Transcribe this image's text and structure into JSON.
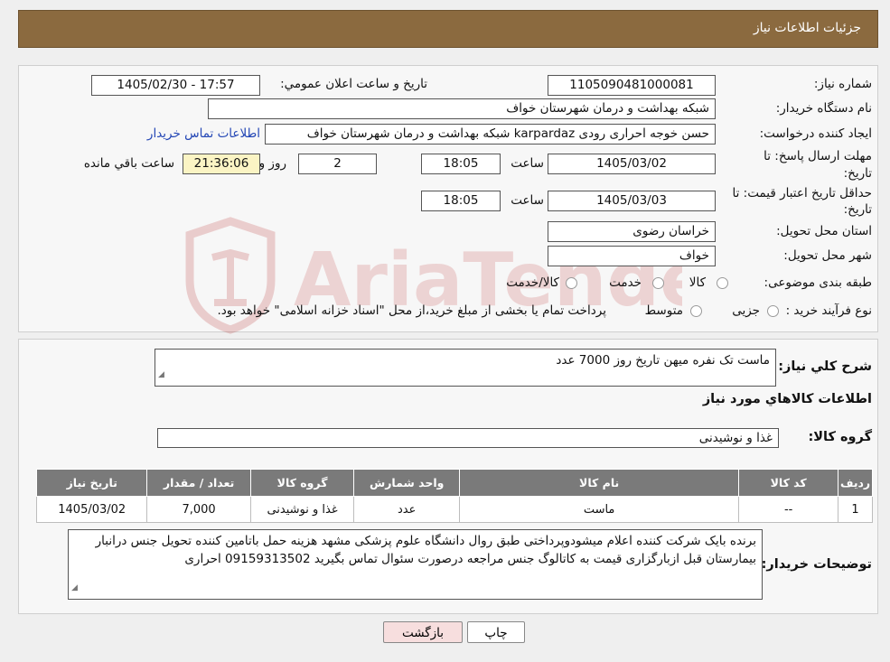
{
  "header": {
    "title": "جزئیات اطلاعات نیاز"
  },
  "form": {
    "need_number_label": "شماره نیاز:",
    "need_number": "1105090481000081",
    "announce_label": "تاريخ و ساعت اعلان عمومي:",
    "announce_value": "1405/02/30 - 17:57",
    "buyer_org_label": "نام دستگاه خریدار:",
    "buyer_org": "شبکه بهداشت و درمان شهرستان خواف",
    "creator_label": "ایجاد کننده درخواست:",
    "creator": "حسن خوجه احراری رودی karpardaz شبکه بهداشت و درمان شهرستان خواف",
    "contact_link": "اطلاعات تماس خریدار",
    "deadline_label_1": "مهلت ارسال پاسخ: تا",
    "deadline_label_2": "تاریخ:",
    "deadline_date": "1405/03/02",
    "time_label": "ساعت",
    "deadline_time": "18:05",
    "days_remaining": "2",
    "day_and_label": "روز و",
    "remaining_time": "21:36:06",
    "remaining_label": "ساعت باقي مانده",
    "price_valid_label_1": "حداقل تاریخ اعتبار قیمت: تا",
    "price_valid_label_2": "تاریخ:",
    "price_valid_date": "1405/03/03",
    "price_valid_time": "18:05",
    "province_label": "استان محل تحویل:",
    "province": "خراسان رضوی",
    "city_label": "شهر محل تحویل:",
    "city": "خواف",
    "category_label": "طبقه بندی موضوعی:",
    "category_options": [
      "کالا",
      "خدمت",
      "کالا/خدمت"
    ],
    "process_label": "نوع فرآیند خرید :",
    "process_options": [
      "جزیی",
      "متوسط"
    ],
    "process_note": "پرداخت تمام یا بخشی از مبلغ خرید،از محل \"اسناد خزانه اسلامی\" خواهد بود."
  },
  "details": {
    "summary_label": "شرح کلي نياز:",
    "summary": "ماست تک نفره میهن تاریخ روز 7000 عدد",
    "goods_info_title": "اطلاعات کالاهاي مورد نياز",
    "goods_group_label": "گروه کالا:",
    "goods_group": "غذا و نوشیدنی",
    "table": {
      "headers": [
        "ردیف",
        "کد کالا",
        "نام کالا",
        "واحد شمارش",
        "گروه کالا",
        "تعداد / مقدار",
        "تاریخ نیاز"
      ],
      "rows": [
        [
          "1",
          "--",
          "ماست",
          "عدد",
          "غذا و نوشیدنی",
          "7,000",
          "1405/03/02"
        ]
      ]
    },
    "buyer_notes_label": "توضیحات خریدار:",
    "buyer_notes": "برنده بایک شرکت کننده اعلام میشودوپرداختی طبق روال دانشگاه علوم پزشکی مشهد هزینه حمل باتامین کننده تحویل جنس درانبار بیمارستان قبل ازبارگزاری قیمت به کاتالوگ جنس مراجعه درصورت سئوال تماس بگیرید 09159313502 احراری"
  },
  "buttons": {
    "print": "چاپ",
    "back": "بازگشت"
  },
  "watermark": {
    "text": "AriaTender.neT"
  },
  "colors": {
    "header_bg": "#8b6a3f",
    "table_header_bg": "#7a7a7a",
    "link": "#2346b5",
    "back_button_bg": "#f7dede",
    "print_button_bg": "#ffffff"
  }
}
